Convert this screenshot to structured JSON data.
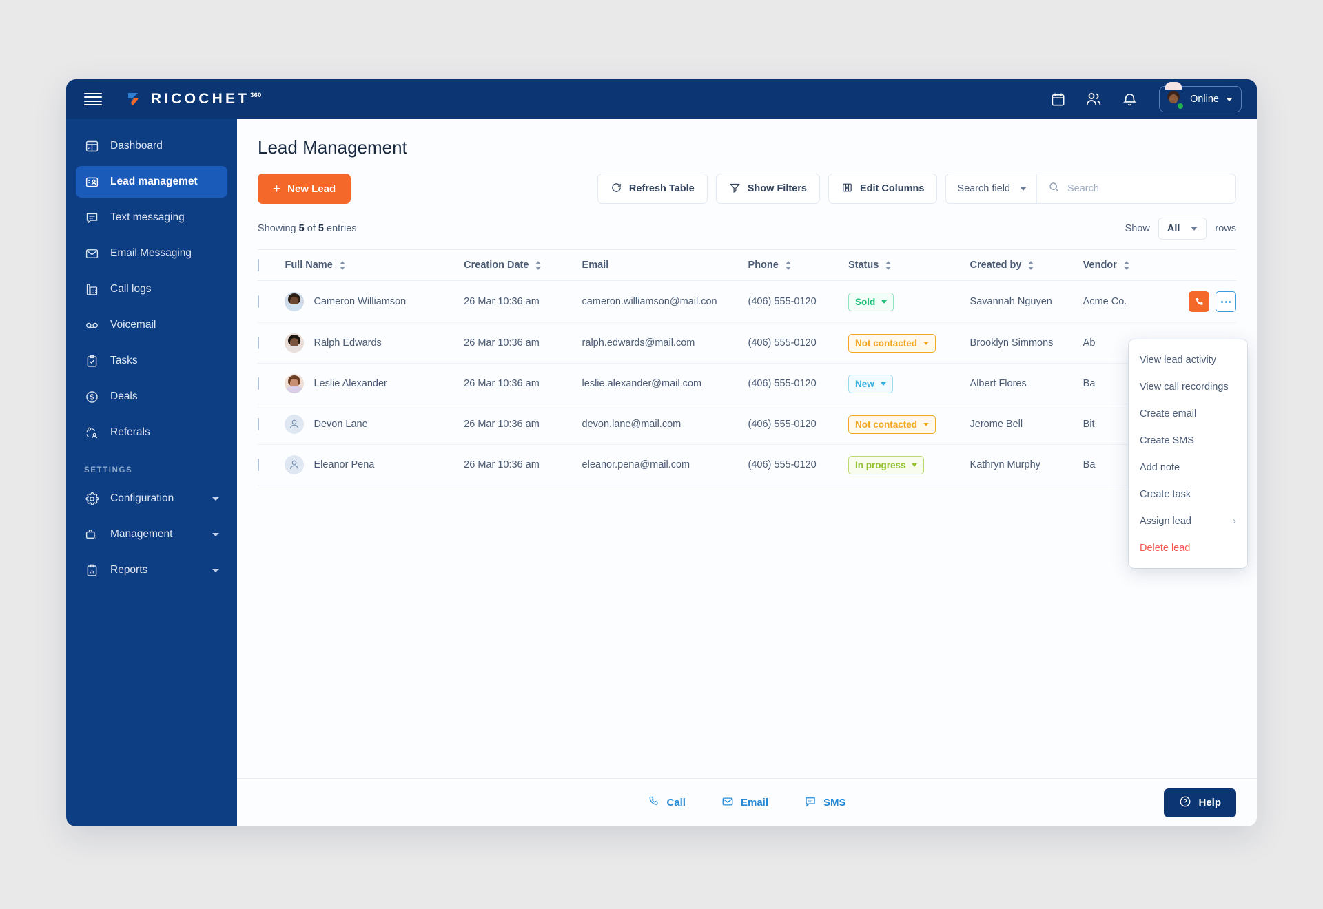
{
  "brand": {
    "name": "RICOCHET",
    "sup": "360"
  },
  "topbar": {
    "icons": [
      "calendar-icon",
      "people-icon",
      "bell-icon"
    ],
    "status_label": "Online"
  },
  "sidebar": {
    "items": [
      {
        "label": "Dashboard",
        "icon": "dashboard-icon",
        "active": false
      },
      {
        "label": "Lead managemet",
        "icon": "lead-management-icon",
        "active": true
      },
      {
        "label": "Text messaging",
        "icon": "chat-icon",
        "active": false
      },
      {
        "label": "Email Messaging",
        "icon": "envelope-icon",
        "active": false
      },
      {
        "label": "Call logs",
        "icon": "desk-phone-icon",
        "active": false
      },
      {
        "label": "Voicemail",
        "icon": "voicemail-icon",
        "active": false
      },
      {
        "label": "Tasks",
        "icon": "clipboard-check-icon",
        "active": false
      },
      {
        "label": "Deals",
        "icon": "dollar-circle-icon",
        "active": false
      },
      {
        "label": "Referals",
        "icon": "referrals-icon",
        "active": false
      }
    ],
    "section_label": "SETTINGS",
    "settings_items": [
      {
        "label": "Configuration",
        "icon": "gear-icon"
      },
      {
        "label": "Management",
        "icon": "briefcase-icon"
      },
      {
        "label": "Reports",
        "icon": "report-clipboard-icon"
      }
    ]
  },
  "page": {
    "title": "Lead Management"
  },
  "toolbar": {
    "new_lead": "New Lead",
    "refresh_table": "Refresh Table",
    "show_filters": "Show Filters",
    "edit_columns": "Edit Columns",
    "search_field_label": "Search field",
    "search_placeholder": "Search",
    "search_value": ""
  },
  "table_meta": {
    "showing_prefix": "Showing",
    "shown": "5",
    "of": "of",
    "total": "5",
    "entries_suffix": "entries",
    "show_label": "Show",
    "rows_value": "All",
    "rows_suffix": "rows"
  },
  "table": {
    "columns": [
      {
        "label": "Full Name",
        "sortable": true
      },
      {
        "label": "Creation Date",
        "sortable": true
      },
      {
        "label": "Email",
        "sortable": false
      },
      {
        "label": "Phone",
        "sortable": true
      },
      {
        "label": "Status",
        "sortable": true
      },
      {
        "label": "Created by",
        "sortable": true
      },
      {
        "label": "Vendor",
        "sortable": true
      }
    ],
    "rows": [
      {
        "name": "Cameron Williamson",
        "date": "26 Mar 10:36 am",
        "email": "cameron.williamson@mail.con",
        "phone": "(406) 555-0120",
        "status": "Sold",
        "status_key": "sold",
        "created_by": "Savannah Nguyen",
        "vendor": "Acme Co.",
        "avatar": "photo"
      },
      {
        "name": "Ralph Edwards",
        "date": "26 Mar 10:36 am",
        "email": "ralph.edwards@mail.com",
        "phone": "(406) 555-0120",
        "status": "Not contacted",
        "status_key": "notcontacted",
        "created_by": "Brooklyn Simmons",
        "vendor": "Ab",
        "avatar": "photo"
      },
      {
        "name": "Leslie Alexander",
        "date": "26 Mar 10:36 am",
        "email": "leslie.alexander@mail.com",
        "phone": "(406) 555-0120",
        "status": "New",
        "status_key": "new",
        "created_by": "Albert Flores",
        "vendor": "Ba",
        "avatar": "photo"
      },
      {
        "name": "Devon Lane",
        "date": "26 Mar 10:36 am",
        "email": "devon.lane@mail.com",
        "phone": "(406) 555-0120",
        "status": "Not contacted",
        "status_key": "notcontacted",
        "created_by": "Jerome Bell",
        "vendor": "Bit",
        "avatar": "placeholder"
      },
      {
        "name": "Eleanor Pena",
        "date": "26 Mar 10:36 am",
        "email": "eleanor.pena@mail.com",
        "phone": "(406) 555-0120",
        "status": "In progress",
        "status_key": "inprogress",
        "created_by": "Kathryn Murphy",
        "vendor": "Ba",
        "avatar": "placeholder"
      }
    ]
  },
  "context_menu": {
    "items": [
      {
        "label": "View lead activity",
        "danger": false,
        "submenu": false
      },
      {
        "label": "View call recordings",
        "danger": false,
        "submenu": false
      },
      {
        "label": "Create email",
        "danger": false,
        "submenu": false
      },
      {
        "label": "Create SMS",
        "danger": false,
        "submenu": false
      },
      {
        "label": "Add note",
        "danger": false,
        "submenu": false
      },
      {
        "label": "Create task",
        "danger": false,
        "submenu": false
      },
      {
        "label": "Assign lead",
        "danger": false,
        "submenu": true
      },
      {
        "label": "Delete lead",
        "danger": true,
        "submenu": false
      }
    ]
  },
  "footer": {
    "actions": [
      {
        "label": "Call",
        "icon": "phone-icon"
      },
      {
        "label": "Email",
        "icon": "envelope-icon"
      },
      {
        "label": "SMS",
        "icon": "chat-icon"
      }
    ],
    "help": "Help"
  },
  "colors": {
    "brand_navy": "#0b3573",
    "sidebar_navy": "#0d3d82",
    "sidebar_active": "#1a5ab8",
    "accent_orange": "#f4682a",
    "link_blue": "#2489d6",
    "status_sold": "#22c17b",
    "status_not_contacted": "#f5a623",
    "status_new": "#35aee0",
    "status_in_progress": "#92c230",
    "danger_red": "#f4584f",
    "online_green": "#22b24c"
  }
}
